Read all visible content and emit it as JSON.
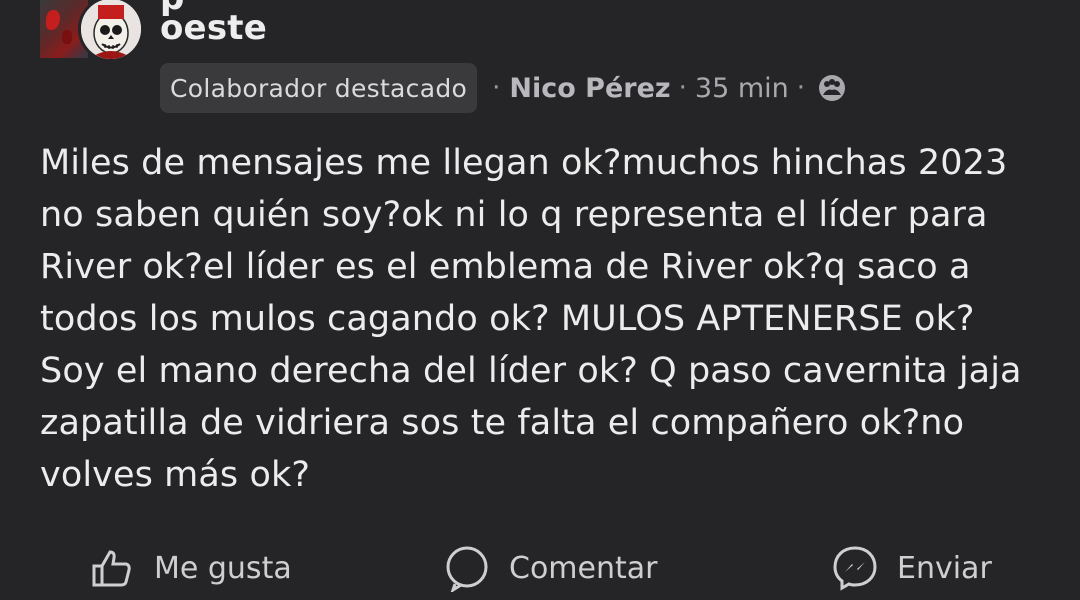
{
  "post": {
    "group_line_cut": "p",
    "group_name": "oeste",
    "badge": "Colaborador destacado",
    "author": "Nico Pérez",
    "time": "35 min",
    "separator": "·",
    "text": "Miles de mensajes me llegan ok?muchos hinchas 2023 no saben quién soy?ok ni lo q representa el líder para River ok?el líder es el emblema de River ok?q saco a todos los mulos cagando ok? MULOS APTENERSE ok? Soy el mano derecha del líder ok? Q paso cavernita jaja zapatilla de vidriera sos te falta el compañero ok?no volves más ok?"
  },
  "actions": {
    "like_label": "Me gusta",
    "comment_label": "Comentar",
    "send_label": "Enviar"
  },
  "icons": {
    "privacy": "group-privacy-icon",
    "like": "thumbs-up-icon",
    "comment": "comment-bubble-icon",
    "send": "messenger-icon"
  },
  "colors": {
    "background": "#252527",
    "text": "#ececed",
    "badge_bg": "#3a3a3d",
    "muted": "#a9a9ad"
  }
}
